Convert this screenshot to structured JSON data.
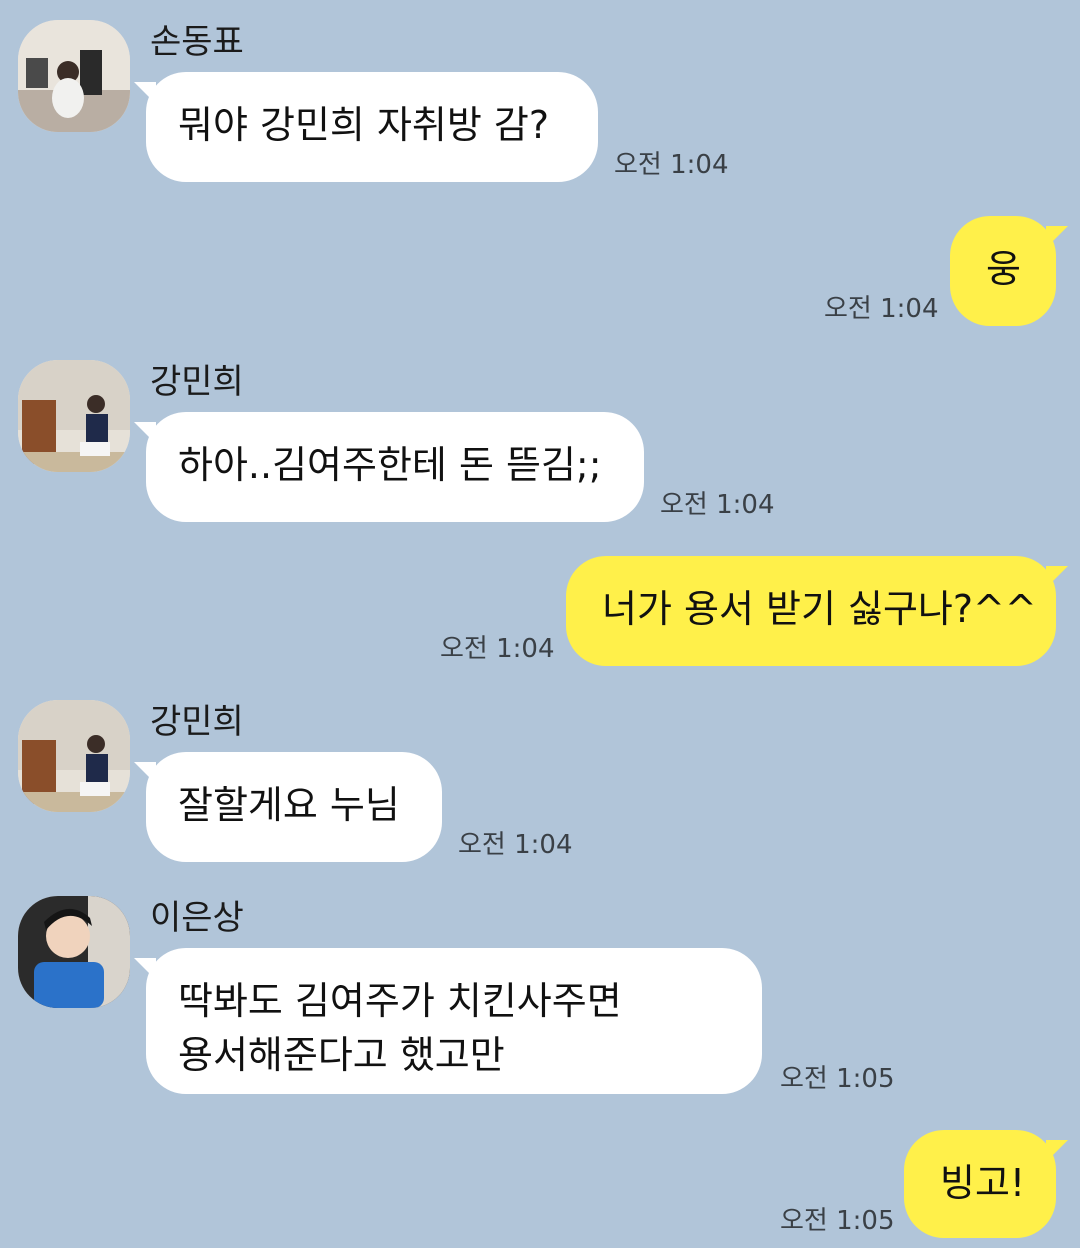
{
  "messages": [
    {
      "sender": "손동표",
      "direction": "in",
      "text": "뭐야 강민희 자취방 감?",
      "time": "오전 1:04"
    },
    {
      "direction": "out",
      "text": "웅",
      "time": "오전 1:04"
    },
    {
      "sender": "강민희",
      "direction": "in",
      "text": "하아..김여주한테 돈 뜯김;;",
      "time": "오전 1:04"
    },
    {
      "direction": "out",
      "text": "너가 용서 받기 싫구나?^^",
      "time": "오전 1:04"
    },
    {
      "sender": "강민희",
      "direction": "in",
      "text": "잘할게요 누님",
      "time": "오전 1:04"
    },
    {
      "sender": "이은상",
      "direction": "in",
      "text_line1": "딱봐도 김여주가 치킨사주면",
      "text_line2": "용서해준다고 했고만",
      "time": "오전 1:05"
    },
    {
      "direction": "out",
      "text": "빙고!",
      "time": "오전 1:05"
    }
  ],
  "colors": {
    "background": "#b1c5d9",
    "incoming_bubble": "#ffffff",
    "outgoing_bubble": "#fff04a"
  }
}
